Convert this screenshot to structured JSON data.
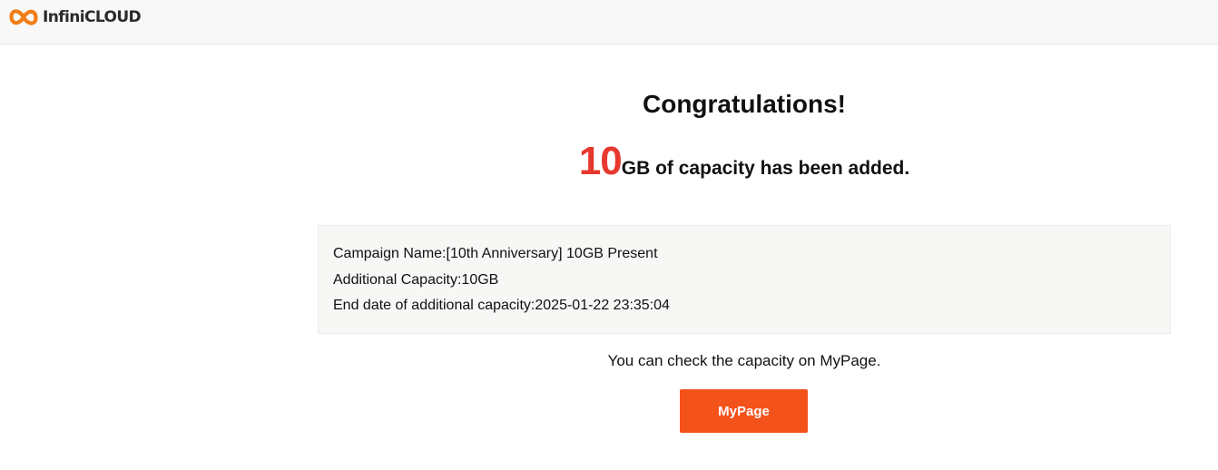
{
  "header": {
    "logo_text": "InfiniCLOUD",
    "logo_icon": "infinity-icon",
    "brand_color": "#f07d17"
  },
  "main": {
    "title": "Congratulations!",
    "headline_number": "10",
    "headline_text": "GB of capacity has been added.",
    "accent_color": "#e6382f",
    "info": [
      {
        "label": "Campaign Name:",
        "value": "[10th Anniversary] 10GB Present"
      },
      {
        "label": "Additional Capacity:",
        "value": "10GB"
      },
      {
        "label": "End date of additional capacity:",
        "value": "2025-01-22 23:35:04"
      }
    ],
    "note": "You can check the capacity on MyPage.",
    "mypage_button": "MyPage",
    "button_color": "#f4521b"
  }
}
